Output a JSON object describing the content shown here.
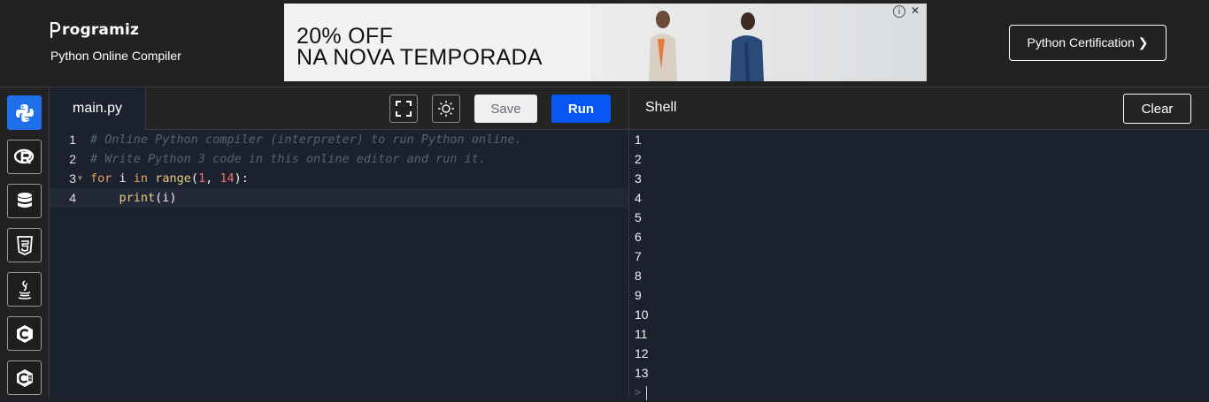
{
  "header": {
    "brand": "rogramiz",
    "subtitle": "Python Online Compiler",
    "certification_button": "Python Certification ❯"
  },
  "ad": {
    "headline_line1": "20% OFF",
    "headline_line2": "NA NOVA TEMPORADA",
    "info_icon": "i",
    "close_icon": "✕"
  },
  "sidebar": {
    "items": [
      {
        "icon": "python-icon",
        "active": true
      },
      {
        "icon": "r-icon",
        "active": false
      },
      {
        "icon": "database-icon",
        "active": false
      },
      {
        "icon": "html5-icon",
        "active": false
      },
      {
        "icon": "java-icon",
        "active": false
      },
      {
        "icon": "c-icon",
        "active": false
      },
      {
        "icon": "csharp-icon",
        "active": false
      }
    ]
  },
  "editor": {
    "file_tab": "main.py",
    "save_label": "Save",
    "run_label": "Run",
    "lines": [
      {
        "num": "1",
        "text": "# Online Python compiler (interpreter) to run Python online."
      },
      {
        "num": "2",
        "text": "# Write Python 3 code in this online editor and run it."
      },
      {
        "num": "3",
        "kw1": "for",
        "pl1": " i ",
        "kw2": "in",
        "pl2": " ",
        "fn": "range",
        "pl3": "(",
        "n1": "1",
        "pl4": ", ",
        "n2": "14",
        "pl5": "):"
      },
      {
        "num": "4",
        "indent": "    ",
        "fn": "print",
        "rest": "(i)"
      }
    ]
  },
  "shell": {
    "title": "Shell",
    "clear_label": "Clear",
    "output": [
      "1",
      "2",
      "3",
      "4",
      "5",
      "6",
      "7",
      "8",
      "9",
      "10",
      "11",
      "12",
      "13"
    ],
    "prompt": ">"
  },
  "colors": {
    "accent": "#0556f3",
    "editor_bg": "#1c2130",
    "header_bg": "#222222"
  }
}
